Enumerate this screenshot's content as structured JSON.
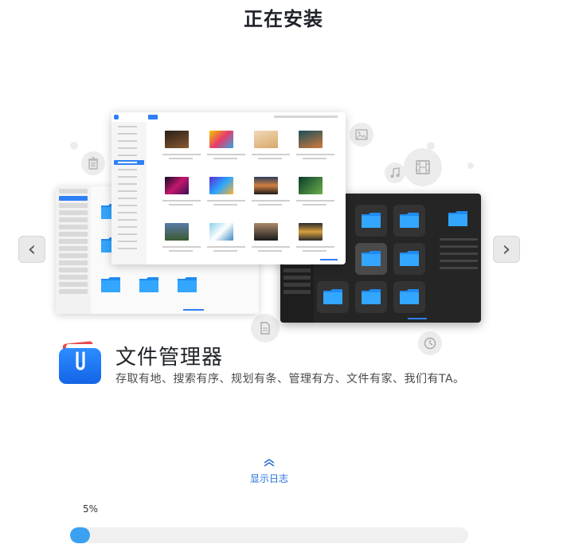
{
  "header": {
    "title": "正在安装"
  },
  "carousel": {
    "prev_glyph": "‹",
    "next_glyph": "›",
    "preview_icons": [
      "trash-icon",
      "image-icon",
      "music-icon",
      "film-icon",
      "document-icon",
      "clock-icon"
    ]
  },
  "app": {
    "name": "文件管理器",
    "description": "存取有地、搜索有序、规划有条、管理有方、文件有家、我们有TA。",
    "brand_color": "#2f7ff7"
  },
  "log": {
    "label": "显示日志"
  },
  "progress": {
    "label": "5%",
    "value": 0.05,
    "color": "#3aa1f2"
  }
}
